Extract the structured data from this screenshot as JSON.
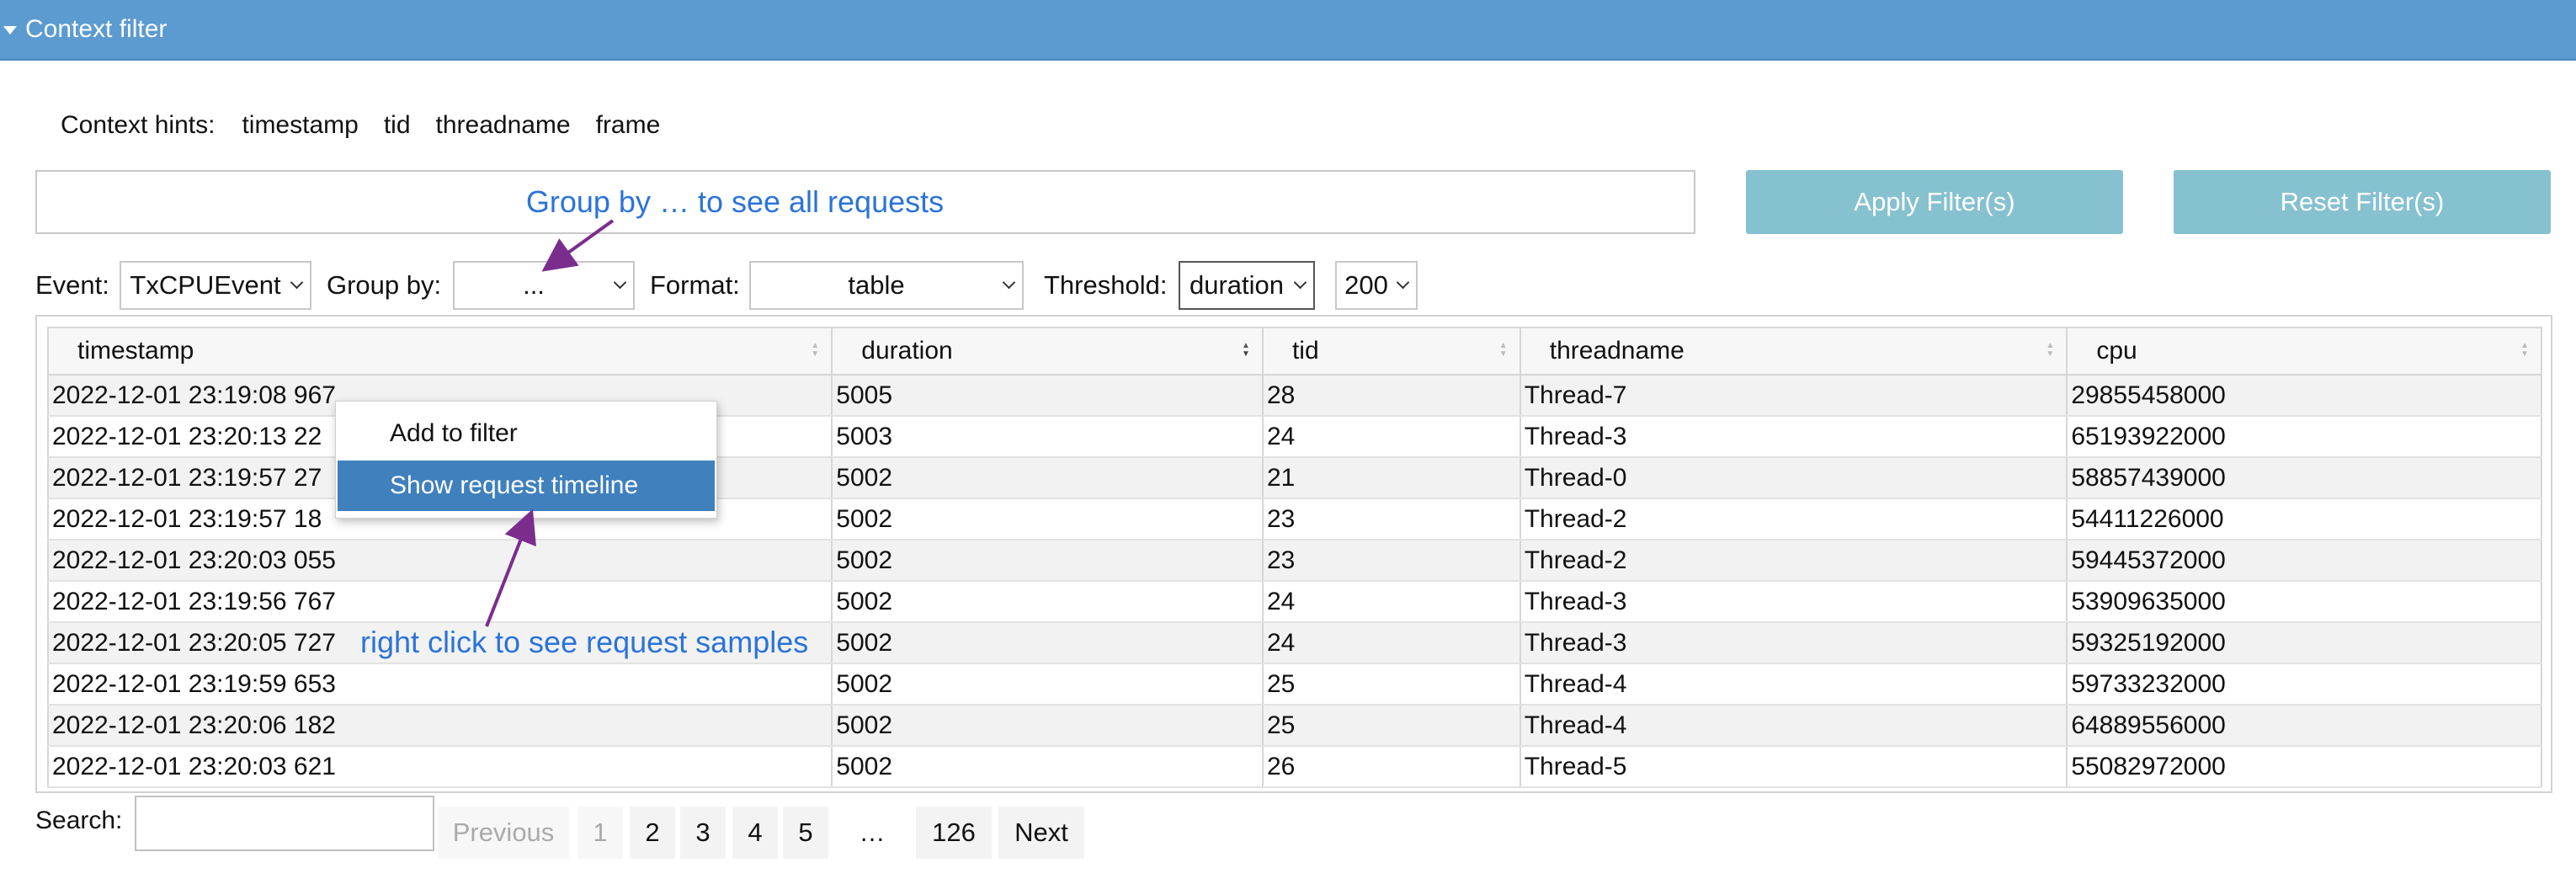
{
  "header": {
    "title": "Context filter"
  },
  "hints": {
    "label": "Context hints:",
    "items": [
      "timestamp",
      "tid",
      "threadname",
      "frame"
    ]
  },
  "filter": {
    "annotation": "Group by … to see all requests",
    "apply_label": "Apply Filter(s)",
    "reset_label": "Reset Filter(s)"
  },
  "controls": {
    "event_label": "Event:",
    "event_value": "TxCPUEvent",
    "groupby_label": "Group by:",
    "groupby_value": "...",
    "format_label": "Format:",
    "format_value": "table",
    "threshold_label": "Threshold:",
    "threshold_value": "duration",
    "threshold_amount": "200"
  },
  "table": {
    "columns": [
      "timestamp",
      "duration",
      "tid",
      "threadname",
      "cpu"
    ],
    "rows": [
      [
        "2022-12-01 23:19:08 967",
        "5005",
        "28",
        "Thread-7",
        "29855458000"
      ],
      [
        "2022-12-01 23:20:13 22",
        "5003",
        "24",
        "Thread-3",
        "65193922000"
      ],
      [
        "2022-12-01 23:19:57 27",
        "5002",
        "21",
        "Thread-0",
        "58857439000"
      ],
      [
        "2022-12-01 23:19:57 18",
        "5002",
        "23",
        "Thread-2",
        "54411226000"
      ],
      [
        "2022-12-01 23:20:03 055",
        "5002",
        "23",
        "Thread-2",
        "59445372000"
      ],
      [
        "2022-12-01 23:19:56 767",
        "5002",
        "24",
        "Thread-3",
        "53909635000"
      ],
      [
        "2022-12-01 23:20:05 727",
        "5002",
        "24",
        "Thread-3",
        "59325192000"
      ],
      [
        "2022-12-01 23:19:59 653",
        "5002",
        "25",
        "Thread-4",
        "59733232000"
      ],
      [
        "2022-12-01 23:20:06 182",
        "5002",
        "25",
        "Thread-4",
        "64889556000"
      ],
      [
        "2022-12-01 23:20:03 621",
        "5002",
        "26",
        "Thread-5",
        "55082972000"
      ]
    ]
  },
  "context_menu": {
    "items": [
      "Add to filter",
      "Show request timeline"
    ],
    "active_index": 1
  },
  "annotation_right_click": "right click to see request samples",
  "search": {
    "label": "Search:",
    "value": ""
  },
  "pagination": {
    "previous": "Previous",
    "pages": [
      "1",
      "2",
      "3",
      "4",
      "5"
    ],
    "ellipsis": "…",
    "last": "126",
    "next": "Next",
    "current": "1"
  },
  "colors": {
    "header_bg": "#5b9bd0",
    "button_bg": "#86c1d0",
    "annotation_text": "#2b73d9",
    "arrow": "#7b2d8e",
    "menu_active": "#3f80bd"
  }
}
